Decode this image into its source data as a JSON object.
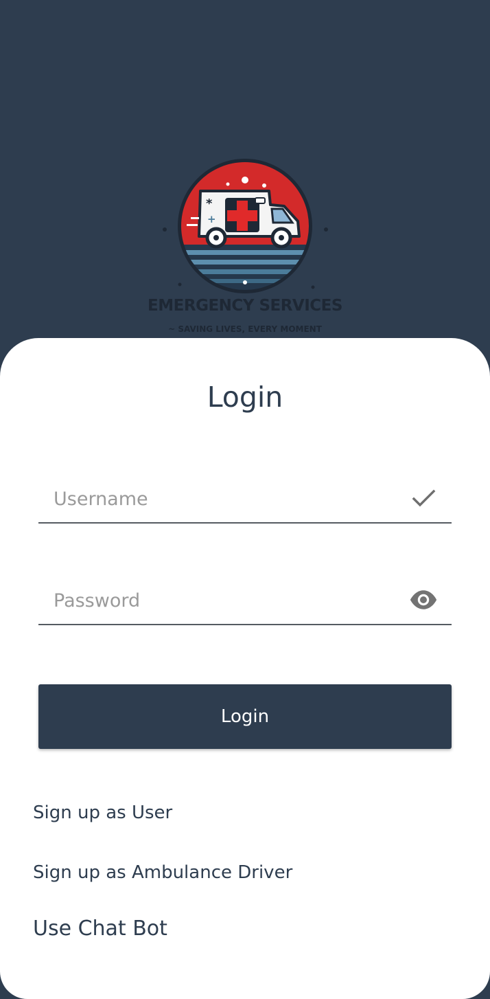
{
  "brand": {
    "name": "EMERGENCY SERVICES",
    "tagline": "~ SAVING LIVES, EVERY MOMENT"
  },
  "login": {
    "title": "Login",
    "username": {
      "placeholder": "Username",
      "value": ""
    },
    "password": {
      "placeholder": "Password",
      "value": ""
    },
    "submit_label": "Login"
  },
  "links": {
    "signup_user": "Sign up as User",
    "signup_driver": "Sign up as Ambulance Driver",
    "chat_bot": "Use Chat Bot"
  },
  "icons": {
    "logo": "ambulance-logo-icon",
    "username_status": "check-icon",
    "password_visibility": "eye-icon"
  },
  "colors": {
    "primary": "#2e3d4f",
    "card": "#ffffff",
    "logo_red": "#d32a2a",
    "logo_blue": "#4b7c9a"
  }
}
